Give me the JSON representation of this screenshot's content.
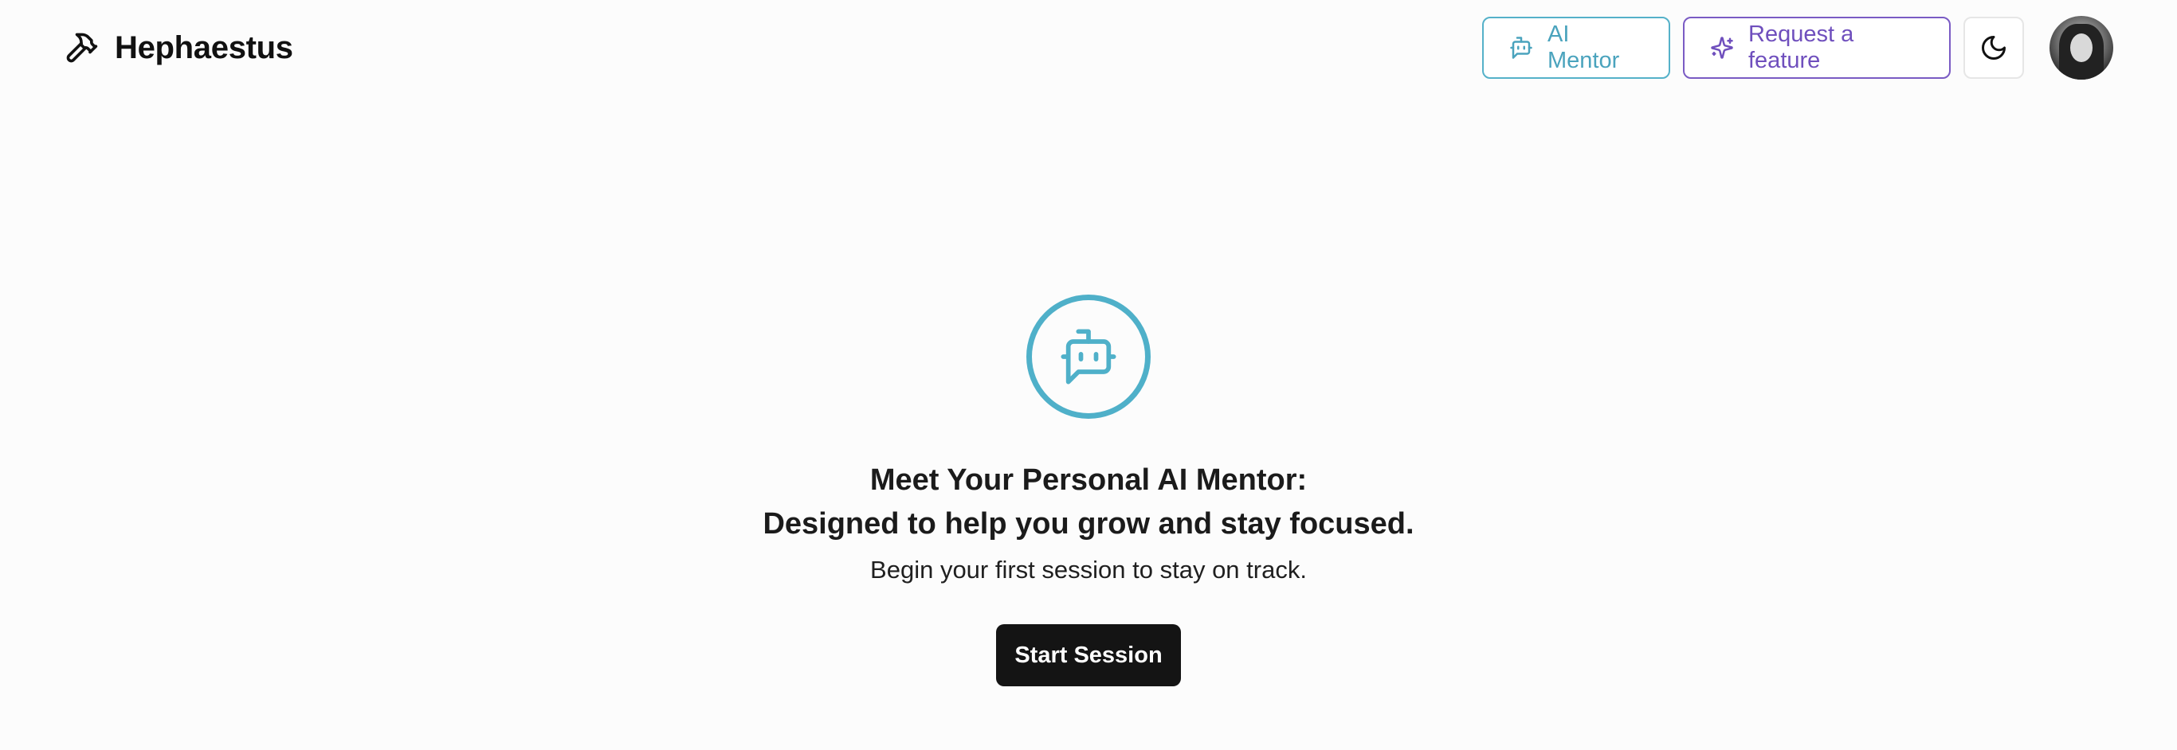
{
  "brand": {
    "name": "Hephaestus",
    "icon": "hammer-icon"
  },
  "header": {
    "ai_mentor_label": "AI Mentor",
    "ai_mentor_icon": "bot-message-icon",
    "request_feature_label": "Request a feature",
    "request_feature_icon": "sparkles-icon",
    "theme_toggle_icon": "moon-icon",
    "avatar": "user-avatar"
  },
  "hero": {
    "icon": "bot-message-icon",
    "headline_line1": "Meet Your Personal AI Mentor:",
    "headline_line2": "Designed to help you grow and stay focused.",
    "subtitle": "Begin your first session to stay on track.",
    "start_button_label": "Start Session"
  },
  "colors": {
    "background": "#fcfcfc",
    "mentor_accent": "#4fb0c9",
    "feature_accent": "#6f4fbd",
    "primary_button": "#141414"
  }
}
